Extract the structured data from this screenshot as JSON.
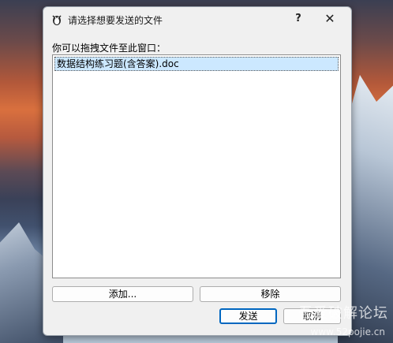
{
  "window": {
    "title": "请选择想要发送的文件",
    "help_label": "?",
    "close_label": "✕"
  },
  "prompt": "你可以拖拽文件至此窗口：",
  "files": [
    {
      "name": "数据结构练习题(含答案).doc",
      "selected": true
    }
  ],
  "buttons": {
    "add": "添加...",
    "remove": "移除",
    "send": "发送",
    "cancel": "取消"
  },
  "watermark": {
    "brand": "吾爱破解论坛",
    "url": "www.52pojie.cn"
  },
  "colors": {
    "selection": "#cce8ff",
    "default_button_border": "#0067c0"
  }
}
